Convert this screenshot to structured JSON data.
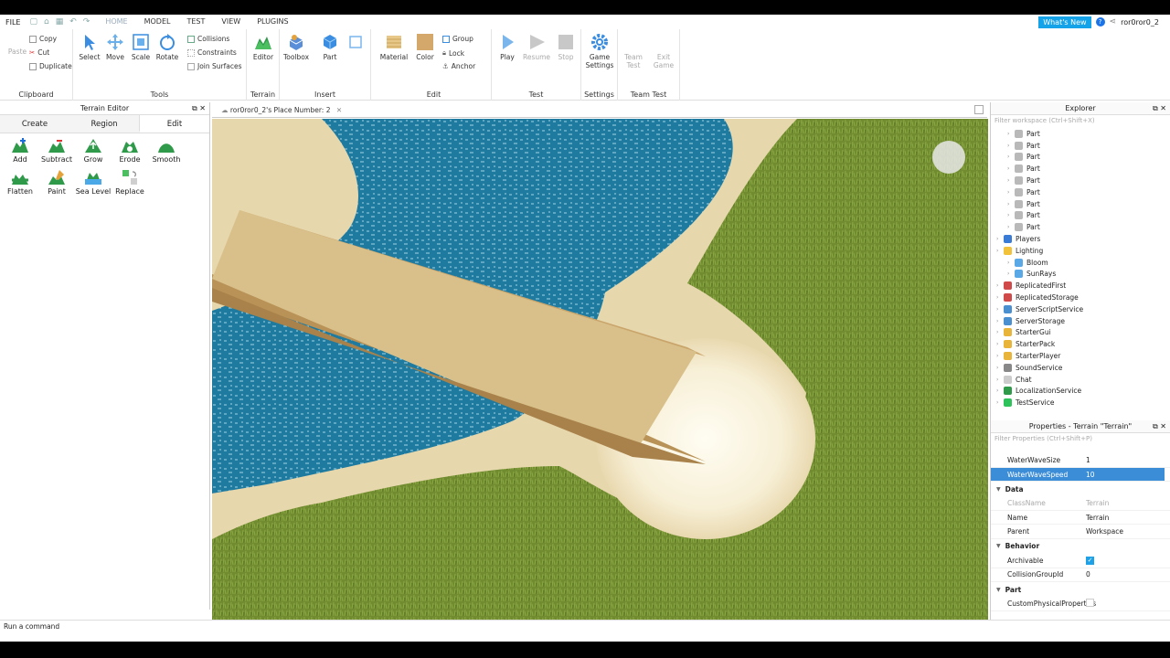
{
  "menu": {
    "file": "FILE",
    "tabs": [
      "HOME",
      "MODEL",
      "TEST",
      "VIEW",
      "PLUGINS"
    ],
    "active_tab": "HOME",
    "whats_new": "What's New",
    "help": "?",
    "username": "ror0ror0_2"
  },
  "ribbon": {
    "clipboard": {
      "paste": "Paste",
      "copy": "Copy",
      "cut": "Cut",
      "duplicate": "Duplicate",
      "label": "Clipboard"
    },
    "tools": {
      "select": "Select",
      "move": "Move",
      "scale": "Scale",
      "rotate": "Rotate",
      "collisions": "Collisions",
      "constraints": "Constraints",
      "join_surfaces": "Join Surfaces",
      "label": "Tools"
    },
    "terrain": {
      "editor": "Editor",
      "label": "Terrain"
    },
    "insert": {
      "toolbox": "Toolbox",
      "part": "Part",
      "label": "Insert"
    },
    "edit": {
      "material": "Material",
      "color": "Color",
      "group": "Group",
      "lock": "Lock",
      "anchor": "Anchor",
      "label": "Edit"
    },
    "test": {
      "play": "Play",
      "resume": "Resume",
      "stop": "Stop",
      "label": "Test"
    },
    "settings": {
      "game_settings_1": "Game",
      "game_settings_2": "Settings",
      "label": "Settings"
    },
    "team_test": {
      "team_test_1": "Team",
      "team_test_2": "Test",
      "exit_game_1": "Exit",
      "exit_game_2": "Game",
      "label": "Team Test"
    }
  },
  "terrain_editor": {
    "title": "Terrain Editor",
    "tabs": [
      "Create",
      "Region",
      "Edit"
    ],
    "active_tab": "Edit",
    "tools": [
      "Add",
      "Subtract",
      "Grow",
      "Erode",
      "Smooth",
      "Flatten",
      "Paint",
      "Sea Level",
      "Replace"
    ]
  },
  "document": {
    "tab_title": "ror0ror0_2's Place Number: 2"
  },
  "explorer": {
    "title": "Explorer",
    "filter_placeholder": "Filter workspace (Ctrl+Shift+X)",
    "items": [
      {
        "label": "Part",
        "indent": 2,
        "icon": "part-icon",
        "color": "#b9b9b9"
      },
      {
        "label": "Part",
        "indent": 2,
        "icon": "part-icon",
        "color": "#b9b9b9"
      },
      {
        "label": "Part",
        "indent": 2,
        "icon": "part-icon",
        "color": "#b9b9b9"
      },
      {
        "label": "Part",
        "indent": 2,
        "icon": "part-icon",
        "color": "#b9b9b9"
      },
      {
        "label": "Part",
        "indent": 2,
        "icon": "part-icon",
        "color": "#b9b9b9"
      },
      {
        "label": "Part",
        "indent": 2,
        "icon": "part-icon",
        "color": "#b9b9b9"
      },
      {
        "label": "Part",
        "indent": 2,
        "icon": "part-icon",
        "color": "#b9b9b9"
      },
      {
        "label": "Part",
        "indent": 2,
        "icon": "part-icon",
        "color": "#b9b9b9"
      },
      {
        "label": "Part",
        "indent": 2,
        "icon": "part-icon",
        "color": "#b9b9b9"
      },
      {
        "label": "Players",
        "indent": 1,
        "icon": "players-icon",
        "color": "#3a7bd5"
      },
      {
        "label": "Lighting",
        "indent": 1,
        "icon": "lighting-icon",
        "color": "#f2c23a"
      },
      {
        "label": "Bloom",
        "indent": 2,
        "icon": "bloom-icon",
        "color": "#5aa9e6"
      },
      {
        "label": "SunRays",
        "indent": 2,
        "icon": "sunrays-icon",
        "color": "#5aa9e6"
      },
      {
        "label": "ReplicatedFirst",
        "indent": 1,
        "icon": "replicated-first-icon",
        "color": "#d04a4a"
      },
      {
        "label": "ReplicatedStorage",
        "indent": 1,
        "icon": "replicated-storage-icon",
        "color": "#d04a4a"
      },
      {
        "label": "ServerScriptService",
        "indent": 1,
        "icon": "server-script-service-icon",
        "color": "#4a8fd0"
      },
      {
        "label": "ServerStorage",
        "indent": 1,
        "icon": "server-storage-icon",
        "color": "#4a8fd0"
      },
      {
        "label": "StarterGui",
        "indent": 1,
        "icon": "starter-gui-icon",
        "color": "#e8b53a"
      },
      {
        "label": "StarterPack",
        "indent": 1,
        "icon": "starter-pack-icon",
        "color": "#e8b53a"
      },
      {
        "label": "StarterPlayer",
        "indent": 1,
        "icon": "starter-player-icon",
        "color": "#e8b53a"
      },
      {
        "label": "SoundService",
        "indent": 1,
        "icon": "sound-service-icon",
        "color": "#888888"
      },
      {
        "label": "Chat",
        "indent": 1,
        "icon": "chat-icon",
        "color": "#cccccc"
      },
      {
        "label": "LocalizationService",
        "indent": 1,
        "icon": "localization-service-icon",
        "color": "#2e9a4a"
      },
      {
        "label": "TestService",
        "indent": 1,
        "icon": "test-service-icon",
        "color": "#2ec35a"
      }
    ]
  },
  "properties": {
    "title": "Properties - Terrain \"Terrain\"",
    "filter_placeholder": "Filter Properties (Ctrl+Shift+P)",
    "rows": [
      {
        "type": "prop",
        "name": "WaterWaveSize",
        "value": "1"
      },
      {
        "type": "prop",
        "name": "WaterWaveSpeed",
        "value": "10",
        "selected": true
      },
      {
        "type": "cat",
        "name": "Data"
      },
      {
        "type": "prop",
        "name": "ClassName",
        "value": "Terrain",
        "dim": true
      },
      {
        "type": "prop",
        "name": "Name",
        "value": "Terrain"
      },
      {
        "type": "prop",
        "name": "Parent",
        "value": "Workspace"
      },
      {
        "type": "cat",
        "name": "Behavior"
      },
      {
        "type": "prop",
        "name": "Archivable",
        "value": "",
        "check": true
      },
      {
        "type": "prop",
        "name": "CollisionGroupId",
        "value": "0"
      },
      {
        "type": "cat",
        "name": "Part"
      },
      {
        "type": "prop",
        "name": "CustomPhysicalProperties",
        "value": "",
        "check": false
      }
    ]
  },
  "command_bar": {
    "placeholder": "Run a command"
  },
  "colors": {
    "accent": "#14a3e8",
    "selection": "#3b8dd8",
    "terrain_green": "#36a048"
  }
}
